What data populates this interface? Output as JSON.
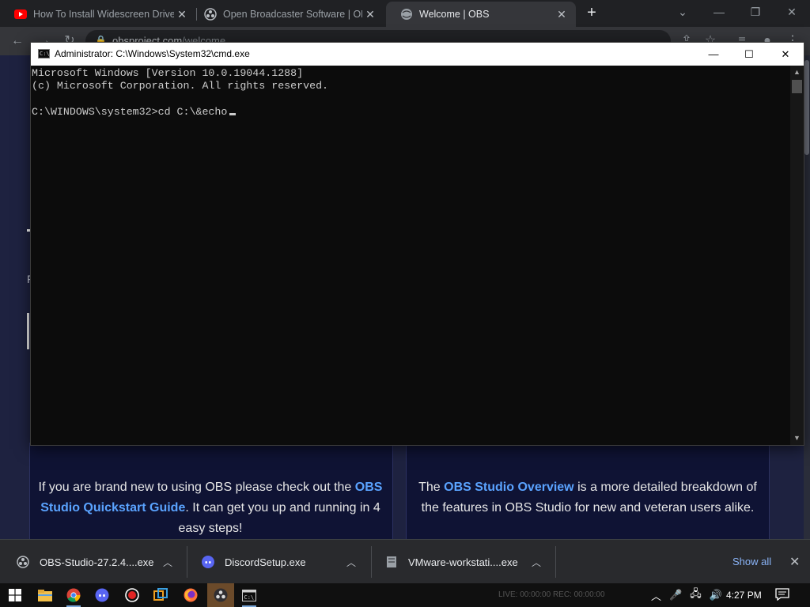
{
  "browser": {
    "tabs": [
      {
        "title": "How To Install Widescreen Driver",
        "icon": "youtube-icon"
      },
      {
        "title": "Open Broadcaster Software | OBS",
        "icon": "obs-icon"
      },
      {
        "title": "Welcome | OBS",
        "icon": "globe-icon",
        "active": true
      }
    ],
    "url_host": "obsproject.com",
    "url_path": "/welcome"
  },
  "page": {
    "card_left_pre": "If you are brand new to using OBS please check out the ",
    "card_left_link": "OBS Studio Quickstart Guide",
    "card_left_post": ". It can get you up and running in 4 easy steps!",
    "card_right_pre": "The ",
    "card_right_link": "OBS Studio Overview",
    "card_right_post": " is a more detailed breakdown of the features in OBS Studio for new and veteran users alike.",
    "left_fragment": "F"
  },
  "cmd": {
    "title": "Administrator: C:\\Windows\\System32\\cmd.exe",
    "lines": [
      "Microsoft Windows [Version 10.0.19044.1288]",
      "(c) Microsoft Corporation. All rights reserved.",
      "",
      "C:\\WINDOWS\\system32>cd C:\\&echo"
    ]
  },
  "downloads": {
    "items": [
      {
        "name": "OBS-Studio-27.2.4....exe",
        "icon": "obs-icon"
      },
      {
        "name": "DiscordSetup.exe",
        "icon": "discord-icon"
      },
      {
        "name": "VMware-workstati....exe",
        "icon": "installer-icon"
      }
    ],
    "show_all": "Show all"
  },
  "taskbar": {
    "clock": "4:27 PM",
    "obs_status": "LIVE: 00:00:00     REC: 00:00:00"
  },
  "colors": {
    "page_bg": "#1e2240",
    "card_bg": "#0f1334",
    "link": "#5aa3ff",
    "cmd_bg": "#0c0c0c",
    "accent_blue": "#8ab4f8"
  }
}
